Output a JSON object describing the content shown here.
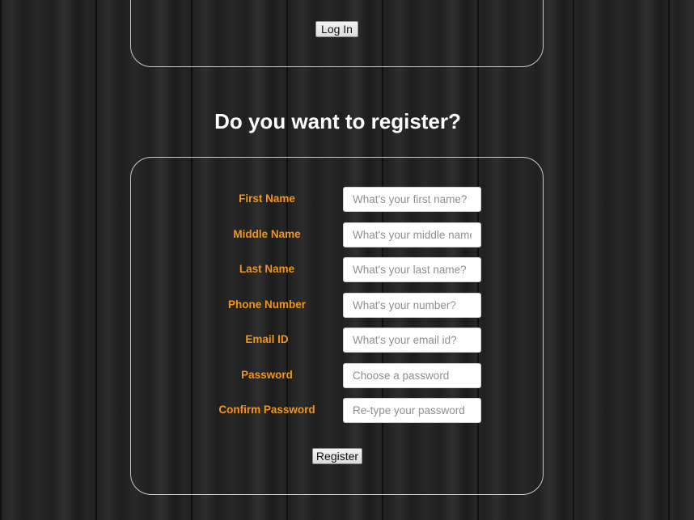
{
  "login": {
    "button_label": "Log In"
  },
  "register": {
    "title": "Do you want to register?",
    "button_label": "Register",
    "fields": [
      {
        "label": "First Name",
        "placeholder": "What's your first name?"
      },
      {
        "label": "Middle Name",
        "placeholder": "What's your middle name?"
      },
      {
        "label": "Last Name",
        "placeholder": "What's your last name?"
      },
      {
        "label": "Phone Number",
        "placeholder": "What's your number?"
      },
      {
        "label": "Email ID",
        "placeholder": "What's your email id?"
      },
      {
        "label": "Password",
        "placeholder": "Choose a password"
      },
      {
        "label": "Confirm Password",
        "placeholder": "Re-type your password"
      }
    ]
  },
  "colors": {
    "label": "#f0951c",
    "title": "#ffffff",
    "panel_border": "#c9c9c9"
  }
}
